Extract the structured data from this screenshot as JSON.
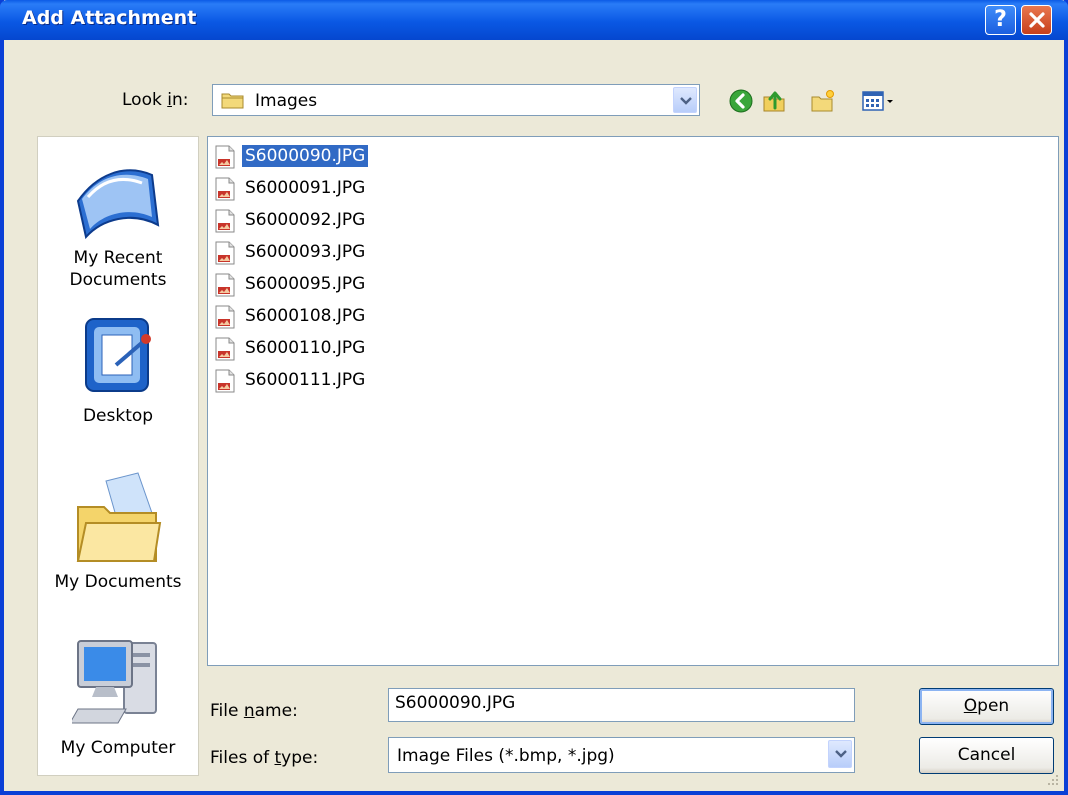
{
  "window": {
    "title": "Add Attachment"
  },
  "lookin": {
    "label_pre": "Look ",
    "label_key": "i",
    "label_post": "n:",
    "value": "Images"
  },
  "toolbar": {
    "back_icon": "back-arrow-icon",
    "up_icon": "up-folder-icon",
    "new_folder_icon": "new-folder-icon",
    "views_icon": "views-menu-icon"
  },
  "places": [
    {
      "label": "My Recent\nDocuments",
      "icon": "recent-documents-icon"
    },
    {
      "label": "Desktop",
      "icon": "desktop-icon"
    },
    {
      "label": "My Documents",
      "icon": "my-documents-icon"
    },
    {
      "label": "My Computer",
      "icon": "my-computer-icon"
    }
  ],
  "files": [
    {
      "name": "S6000090.JPG",
      "selected": true
    },
    {
      "name": "S6000091.JPG"
    },
    {
      "name": "S6000092.JPG"
    },
    {
      "name": "S6000093.JPG"
    },
    {
      "name": "S6000095.JPG"
    },
    {
      "name": "S6000108.JPG"
    },
    {
      "name": "S6000110.JPG"
    },
    {
      "name": "S6000111.JPG"
    }
  ],
  "filename": {
    "label_pre": "File ",
    "label_key": "n",
    "label_post": "ame:",
    "value": "S6000090.JPG"
  },
  "filetype": {
    "label_pre": "Files of ",
    "label_key": "t",
    "label_post": "ype:",
    "value": "Image Files (*.bmp, *.jpg)"
  },
  "buttons": {
    "open_key": "O",
    "open_rest": "pen",
    "cancel": "Cancel"
  },
  "colors": {
    "titlebar": "#0a58e4",
    "selection": "#316ac5",
    "face": "#ece9d8"
  }
}
